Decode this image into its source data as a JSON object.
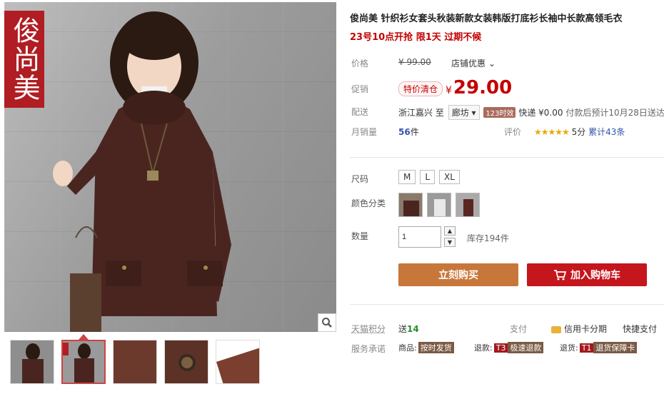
{
  "gallery": {
    "logo_text": "俊尚美",
    "zoom_icon": "magnifier-icon"
  },
  "product": {
    "title": "俊尚美 针织衫女套头秋装新款女装韩版打底衫长袖中长款高领毛衣",
    "promo": "23号10点开抢 限1天 过期不候",
    "price_label": "价格",
    "original_price": "¥ 99.00",
    "discount_link": "店铺优惠",
    "promo_label": "促销",
    "promo_tag": "特价清仓",
    "currency": "¥",
    "sale_price": "29.00",
    "ship_label": "配送",
    "ship_from": "浙江嘉兴",
    "ship_to_word": "至",
    "ship_to": "廊坊",
    "ship_badge": "123时效",
    "ship_fee": "快递 ¥0.00",
    "ship_eta": "付款后预计10月28日送达",
    "sales_label": "月销量",
    "sales_count": "56",
    "sales_unit": "件",
    "rating_label": "评价",
    "stars": "★★★★★",
    "rating_score": "5分",
    "review_count": "累计43条",
    "size_label": "尺码",
    "sizes": [
      "M",
      "L",
      "XL"
    ],
    "color_label": "颜色分类",
    "qty_label": "数量",
    "qty_value": "1",
    "stock": "库存194件",
    "buy_button": "立刻购买",
    "cart_button": "加入购物车",
    "points_label": "天猫积分",
    "points_text": "送",
    "points_value": "14",
    "pay_label": "支付",
    "credit_text": "信用卡分期",
    "quick_pay": "快捷支付",
    "service_label": "服务承诺",
    "service_goods": "商品:",
    "service_goods_badge": "按时发货",
    "service_refund": "退款:",
    "service_refund_code": "T3",
    "service_refund_badge": "极速退款",
    "service_return": "退货:",
    "service_return_code": "T1",
    "service_return_badge": "退货保障卡"
  },
  "colors": {
    "accent_red": "#c40000",
    "buy_orange": "#c8773a",
    "cart_red": "#c4161c",
    "logo_red": "#b01d22"
  }
}
